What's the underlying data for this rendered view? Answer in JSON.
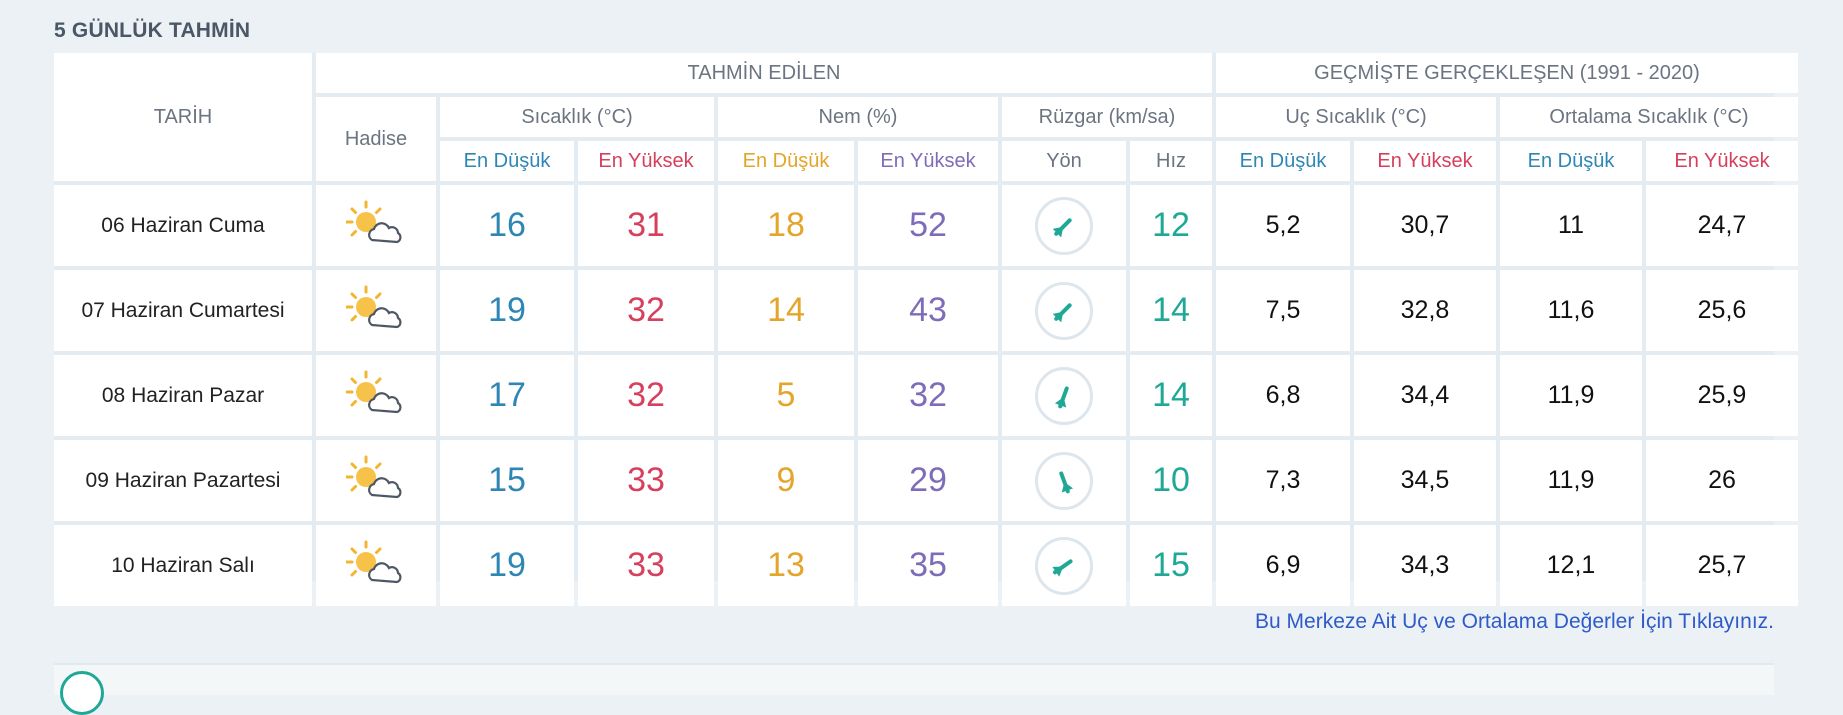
{
  "page_title": "5 GÜNLÜK TAHMİN",
  "headers": {
    "date": "TARİH",
    "forecast_group": "TAHMİN EDİLEN",
    "history_group": "GEÇMİŞTE GERÇEKLEŞEN (1991 - 2020)",
    "event": "Hadise",
    "temperature": "Sıcaklık (°C)",
    "humidity": "Nem (%)",
    "wind": "Rüzgar (km/sa)",
    "extreme_temp": "Uç Sıcaklık (°C)",
    "avg_temp": "Ortalama Sıcaklık (°C)",
    "min": "En Düşük",
    "max": "En Yüksek",
    "direction": "Yön",
    "speed": "Hız"
  },
  "colors": {
    "temp_low": "#2e86b5",
    "temp_high": "#d6405c",
    "hum_low": "#e3a52a",
    "hum_high": "#7f6cb8",
    "wind": "#1fa896",
    "link": "#2e5bc9"
  },
  "rows": [
    {
      "date": "06 Haziran Cuma",
      "icon": "partly-cloudy-icon",
      "t_min": "16",
      "t_max": "31",
      "h_min": "18",
      "h_max": "52",
      "wind_dir_deg": 225,
      "wind_speed": "12",
      "ext_min": "5,2",
      "ext_max": "30,7",
      "avg_min": "11",
      "avg_max": "24,7"
    },
    {
      "date": "07 Haziran Cumartesi",
      "icon": "partly-cloudy-icon",
      "t_min": "19",
      "t_max": "32",
      "h_min": "14",
      "h_max": "43",
      "wind_dir_deg": 225,
      "wind_speed": "14",
      "ext_min": "7,5",
      "ext_max": "32,8",
      "avg_min": "11,6",
      "avg_max": "25,6"
    },
    {
      "date": "08 Haziran Pazar",
      "icon": "partly-cloudy-icon",
      "t_min": "17",
      "t_max": "32",
      "h_min": "5",
      "h_max": "32",
      "wind_dir_deg": 200,
      "wind_speed": "14",
      "ext_min": "6,8",
      "ext_max": "34,4",
      "avg_min": "11,9",
      "avg_max": "25,9"
    },
    {
      "date": "09 Haziran Pazartesi",
      "icon": "partly-cloudy-icon",
      "t_min": "15",
      "t_max": "33",
      "h_min": "9",
      "h_max": "29",
      "wind_dir_deg": 160,
      "wind_speed": "10",
      "ext_min": "7,3",
      "ext_max": "34,5",
      "avg_min": "11,9",
      "avg_max": "26"
    },
    {
      "date": "10 Haziran Salı",
      "icon": "partly-cloudy-icon",
      "t_min": "19",
      "t_max": "33",
      "h_min": "13",
      "h_max": "35",
      "wind_dir_deg": 235,
      "wind_speed": "15",
      "ext_min": "6,9",
      "ext_max": "34,3",
      "avg_min": "12,1",
      "avg_max": "25,7"
    }
  ],
  "footer_link": "Bu Merkeze Ait Uç ve Ortalama Değerler İçin Tıklayınız."
}
